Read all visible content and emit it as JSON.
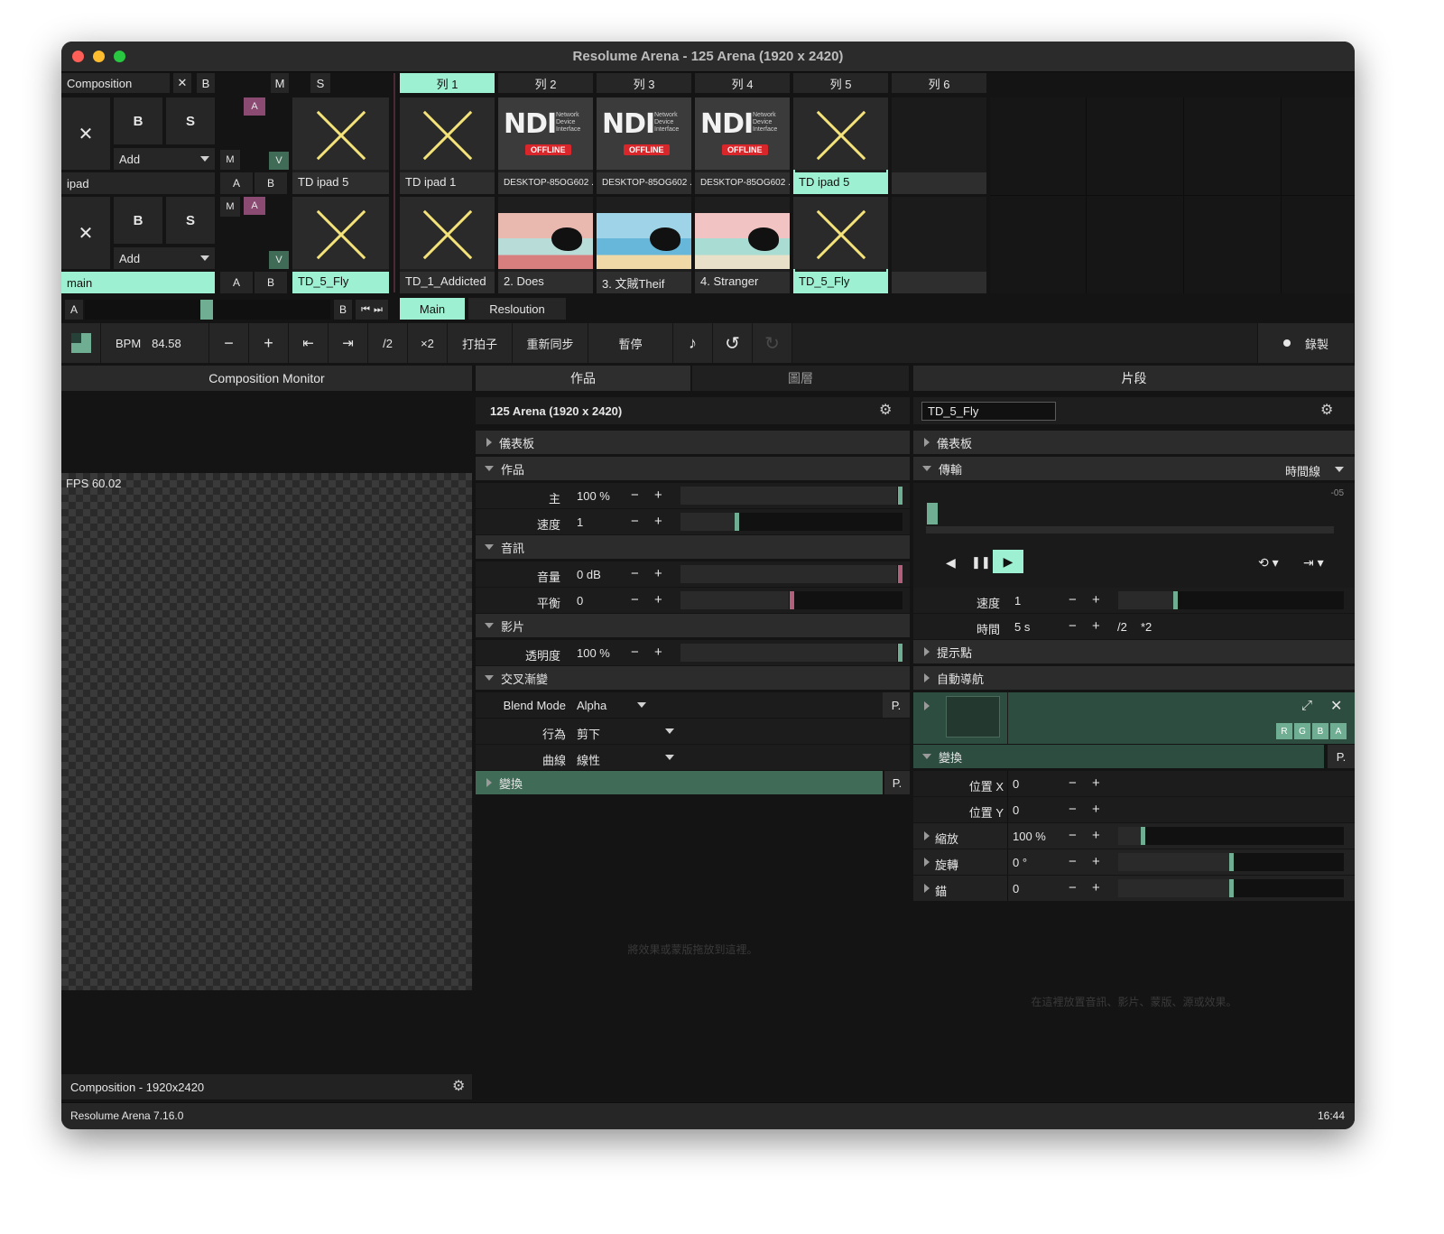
{
  "window": {
    "title": "Resolume Arena - 125 Arena (1920 x 2420)"
  },
  "colors": {
    "accent": "#9ef0d2",
    "layer_a": "#8a4a72",
    "layer_v": "#3f6b57",
    "slider_green": "#6fae92",
    "slider_pink": "#b0607a",
    "ndi_offline": "#d9262b"
  },
  "composition_bar": {
    "label": "Composition",
    "x_label": "✕",
    "b_label": "B",
    "m_label": "M",
    "s_label": "S"
  },
  "columns": [
    "列 1",
    "列 2",
    "列 3",
    "列 4",
    "列 5",
    "列 6"
  ],
  "layers": [
    {
      "name": "ipad",
      "b": "B",
      "s": "S",
      "x": "✕",
      "blend": "Add",
      "m": "M",
      "a_tag": "A",
      "v_tag": "V",
      "a": "A",
      "bb": "B",
      "preview": "TD ipad 5",
      "clips": [
        {
          "label": "TD ipad 1",
          "kind": "x"
        },
        {
          "label": "DESKTOP-85OG602 ...",
          "kind": "ndi"
        },
        {
          "label": "DESKTOP-85OG602 ...",
          "kind": "ndi"
        },
        {
          "label": "DESKTOP-85OG602 ...",
          "kind": "ndi"
        },
        {
          "label": "TD ipad 5",
          "kind": "x"
        },
        {
          "label": "",
          "kind": "empty"
        }
      ]
    },
    {
      "name": "main",
      "b": "B",
      "s": "S",
      "x": "✕",
      "blend": "Add",
      "m": "M",
      "a_tag": "A",
      "v_tag": "V",
      "a": "A",
      "bb": "B",
      "preview": "TD_5_Fly",
      "clips": [
        {
          "label": "TD_1_Addicted",
          "kind": "x"
        },
        {
          "label": "2. Does",
          "kind": "img"
        },
        {
          "label": "3. 文賊Theif",
          "kind": "img"
        },
        {
          "label": "4. Stranger",
          "kind": "img"
        },
        {
          "label": "TD_5_Fly",
          "kind": "x"
        },
        {
          "label": "",
          "kind": "empty"
        }
      ]
    }
  ],
  "ndi": {
    "logo": "NDI",
    "sub": "Network Device Interface",
    "offline": "OFFLINE"
  },
  "crossfader": {
    "a": "A",
    "b": "B",
    "prev_icon": "skip-previous-icon",
    "next_icon": "skip-next-icon"
  },
  "deck_tabs": [
    "Main",
    "Resloution"
  ],
  "transport": {
    "bpm_label": "BPM",
    "bpm_value": "84.58",
    "minus": "−",
    "plus": "+",
    "nudge_left": "⇤",
    "nudge_right": "⇥",
    "half": "/2",
    "double": "×2",
    "tap": "打拍子",
    "resync": "重新同步",
    "pause": "暫停",
    "record": "錄製"
  },
  "monitor": {
    "title": "Composition Monitor",
    "fps": "FPS 60.02",
    "footer": "Composition - 1920x2420"
  },
  "composition_panel": {
    "tabs": [
      "作品",
      "圖層"
    ],
    "name": "125 Arena (1920 x 2420)",
    "sections": {
      "dashboard": "儀表板",
      "composition": "作品",
      "audio": "音訊",
      "video": "影片",
      "crossfade": "交叉漸變",
      "transform": "變換"
    },
    "rows": {
      "master": {
        "label": "主",
        "value": "100 %",
        "level": 1.0
      },
      "speed": {
        "label": "速度",
        "value": "1",
        "level": 0.25
      },
      "volume": {
        "label": "音量",
        "value": "0 dB",
        "level": 1.0
      },
      "pan": {
        "label": "平衡",
        "value": "0",
        "level": 0.5
      },
      "opacity": {
        "label": "透明度",
        "value": "100 %",
        "level": 1.0
      }
    },
    "blend_mode": {
      "label": "Blend Mode",
      "value": "Alpha"
    },
    "behaviour": {
      "label": "行為",
      "value": "剪下"
    },
    "curve": {
      "label": "曲線",
      "value": "線性"
    },
    "p_label": "P.",
    "drop_hint": "將效果或蒙版拖放到這裡。"
  },
  "clip_panel": {
    "title": "片段",
    "clip_name": "TD_5_Fly",
    "sections": {
      "dashboard": "儀表板",
      "transport": "傳輸",
      "cue_points": "提示點",
      "autopilot": "自動導航",
      "transform": "變換"
    },
    "timeline_mode": "時間線",
    "timeline_marker": "-05",
    "speed": {
      "label": "速度",
      "value": "1",
      "level": 0.25
    },
    "duration": {
      "label": "時間",
      "value": "5 s",
      "half": "/2",
      "double": "*2"
    },
    "channels": [
      "R",
      "G",
      "B",
      "A"
    ],
    "p_label": "P.",
    "position_x": {
      "label": "位置 X",
      "value": "0"
    },
    "position_y": {
      "label": "位置 Y",
      "value": "0"
    },
    "scale": {
      "label": "縮放",
      "value": "100 %",
      "level": 0.1
    },
    "rotation": {
      "label": "旋轉",
      "value": "0 °",
      "level": 0.5
    },
    "anchor": {
      "label": "錨",
      "value": "0",
      "level": 0.5
    },
    "drop_hint": "在這裡放置音訊、影片、蒙版、源或效果。"
  },
  "status_bar": {
    "version": "Resolume Arena 7.16.0",
    "time": "16:44"
  }
}
